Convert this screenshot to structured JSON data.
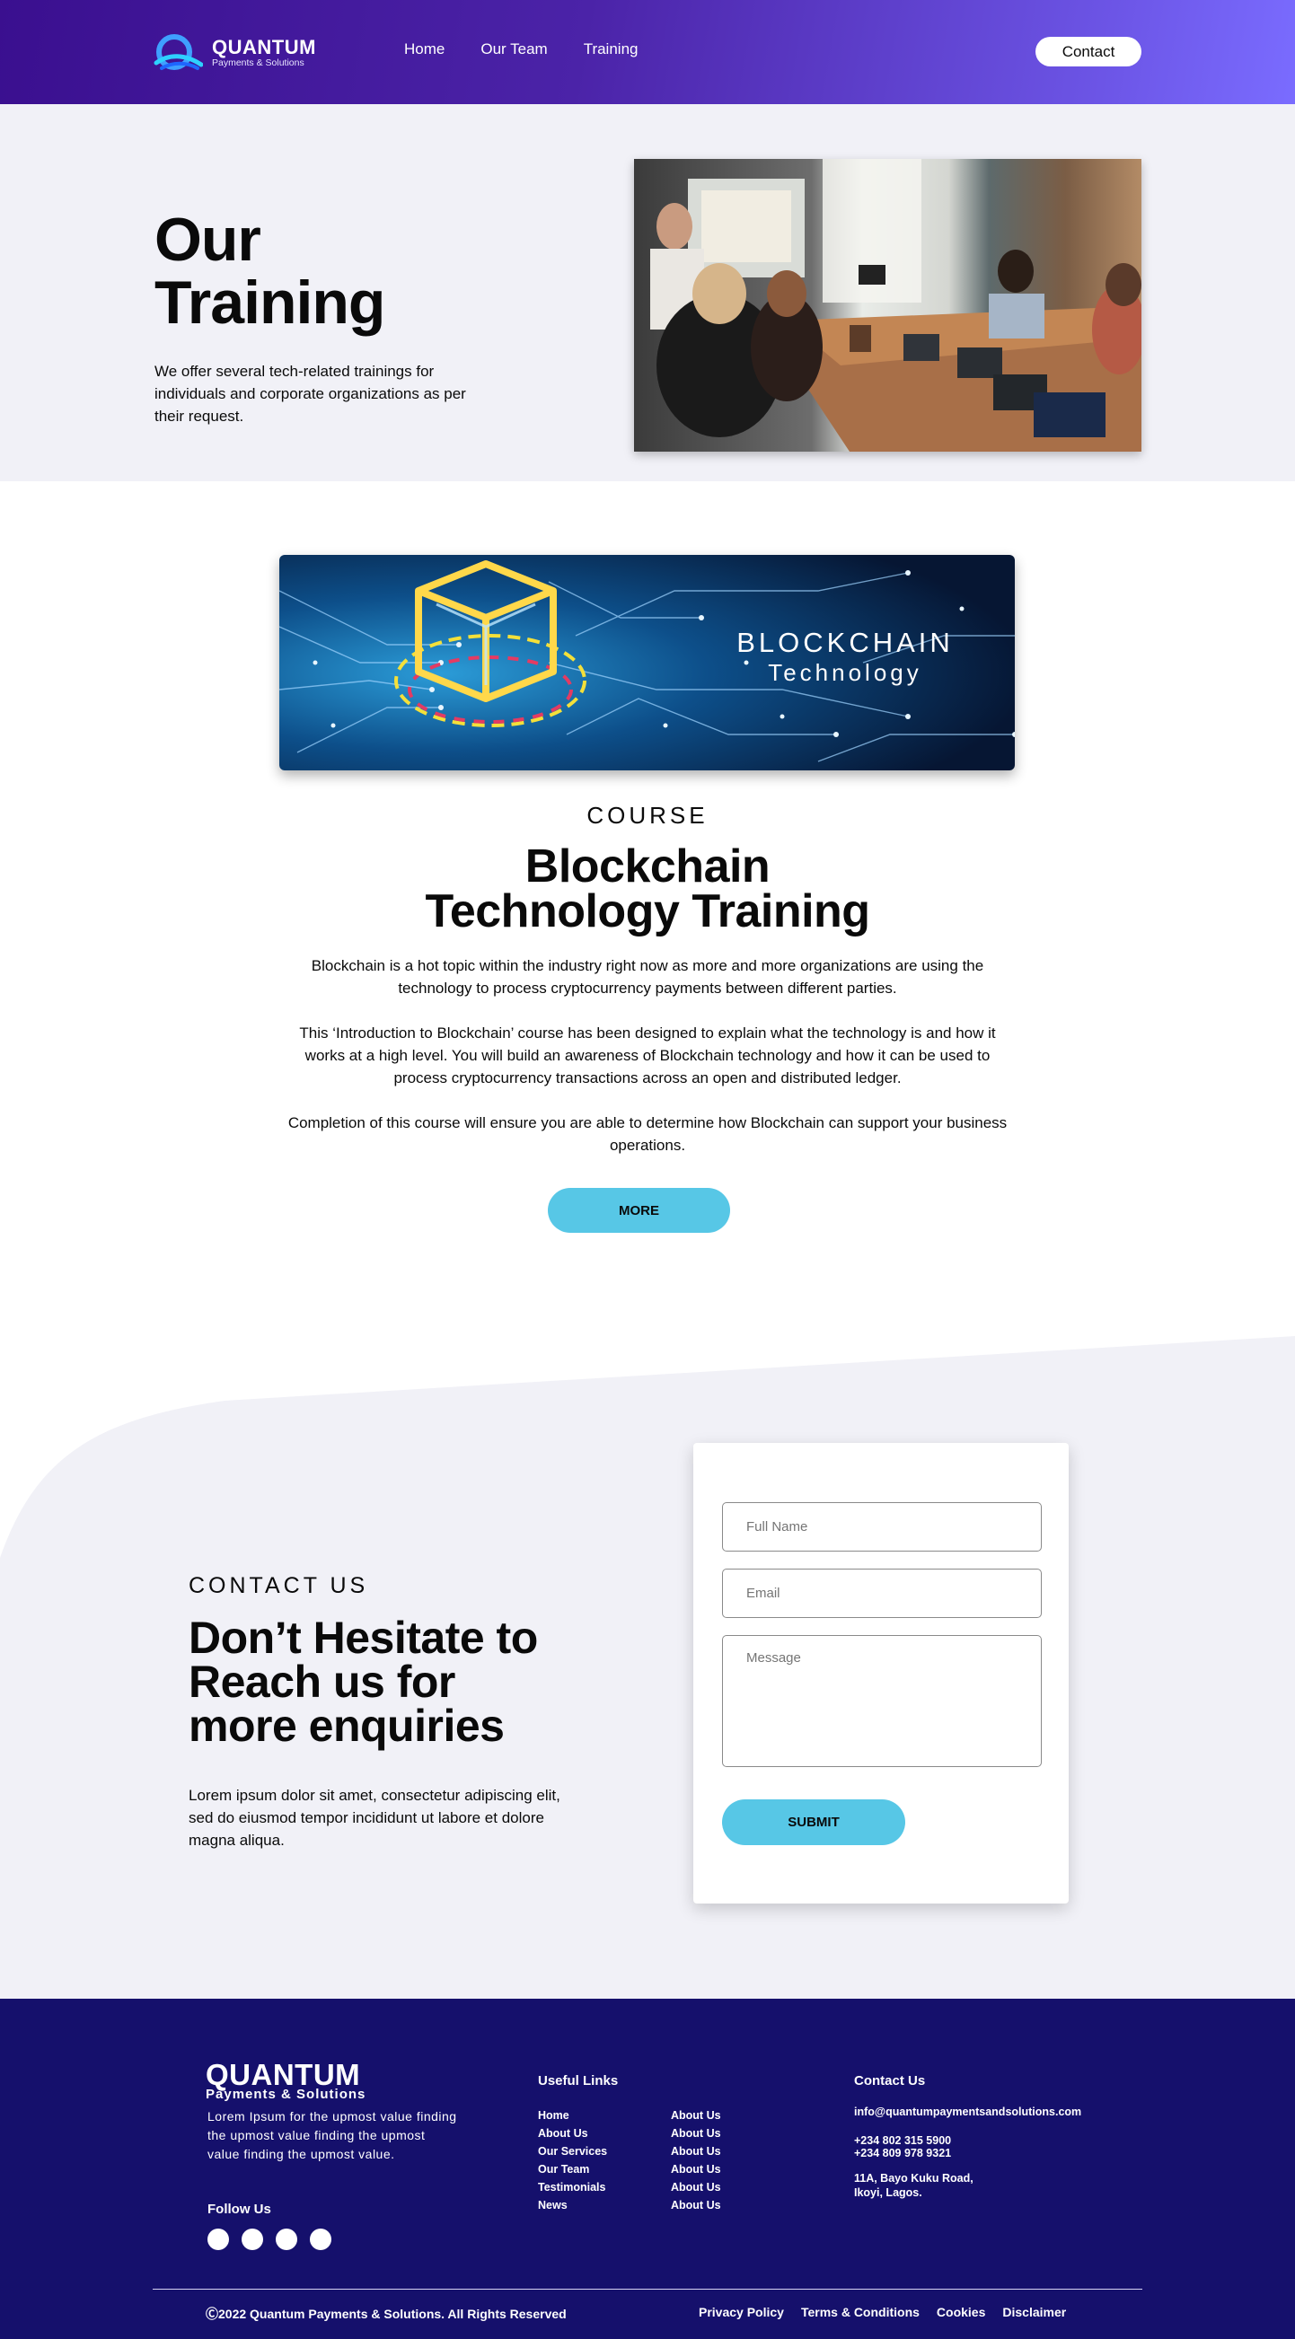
{
  "header": {
    "logo_name": "QUANTUM",
    "logo_tagline": "Payments & Solutions",
    "nav": [
      {
        "label": "Home"
      },
      {
        "label": "Our Team"
      },
      {
        "label": "Training"
      }
    ],
    "contact_button": "Contact",
    "gradient_start": "#3a0f8f",
    "gradient_end": "#7a6cff"
  },
  "hero": {
    "title_line1": "Our",
    "title_line2": "Training",
    "description": "We offer several tech-related trainings for individuals and corporate organizations as per their request.",
    "photo_alt": "meeting-room-photo"
  },
  "course": {
    "banner_title": "BLOCKCHAIN",
    "banner_subtitle": "Technology",
    "kicker": "COURSE",
    "title_line1": "Blockchain",
    "title_line2": "Technology Training",
    "paragraphs": [
      "Blockchain is a hot topic within the industry right now as more and more organizations are using the technology to process cryptocurrency payments between different parties.",
      "This ‘Introduction to Blockchain’ course has been designed to explain what the technology is and how it works at a high level. You will build an awareness of Blockchain technology and how it can be used to process cryptocurrency transactions across an open and distributed ledger.",
      "Completion of this course will ensure you are able to determine how Blockchain can support your business operations."
    ],
    "more_button": "MORE",
    "accent": "#57c7e6"
  },
  "contact": {
    "kicker": "CONTACT US",
    "title_line1": "Don’t Hesitate to",
    "title_line2": "Reach us for",
    "title_line3": "more enquiries",
    "description": "Lorem ipsum dolor sit amet, consectetur adipiscing elit, sed do eiusmod tempor incididunt ut labore et dolore magna aliqua.",
    "form": {
      "name_placeholder": "Full Name",
      "email_placeholder": "Email",
      "message_placeholder": "Message",
      "submit_label": "SUBMIT"
    }
  },
  "footer": {
    "logo_name": "QUANTUM",
    "logo_tagline": "Payments & Solutions",
    "description": "Lorem Ipsum for the upmost value finding the upmost value finding the upmost value finding the upmost value.",
    "follow_label": "Follow Us",
    "socials": [
      "social-icon-1",
      "social-icon-2",
      "social-icon-3",
      "social-icon-4"
    ],
    "useful_links_heading": "Useful Links",
    "links_col1": [
      "Home",
      "About Us",
      "Our Services",
      "Our Team",
      "Testimonials",
      "News"
    ],
    "links_col2": [
      "About Us",
      "About Us",
      "About Us",
      "About Us",
      "About Us",
      "About Us"
    ],
    "contact_heading": "Contact Us",
    "email": "info@quantumpaymentsandsolutions.com",
    "phone1": "+234 802 315 5900",
    "phone2": "+234 809 978 9321",
    "address_line1": "11A, Bayo Kuku Road,",
    "address_line2": "Ikoyi, Lagos.",
    "copyright": "Ⓒ2022 Quantum Payments & Solutions. All Rights Reserved",
    "legal": [
      "Privacy Policy",
      "Terms & Conditions",
      "Cookies",
      "Disclaimer"
    ],
    "background": "#15106c"
  }
}
